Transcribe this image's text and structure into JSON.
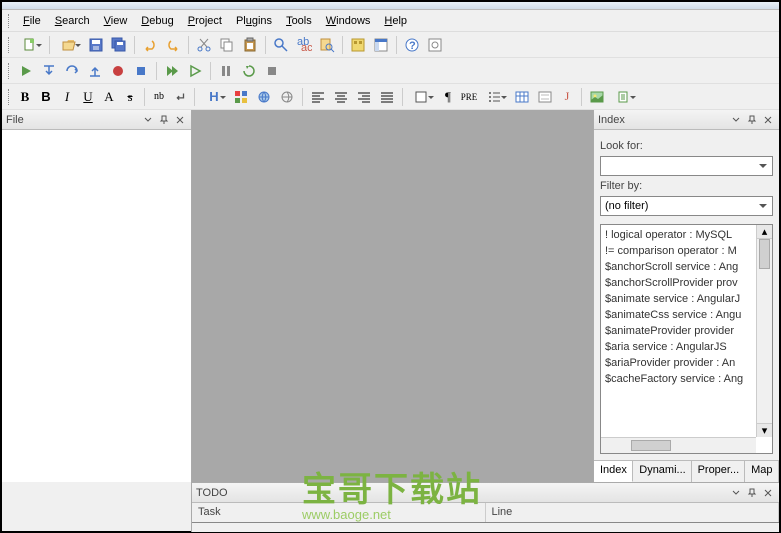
{
  "menu": {
    "file": "File",
    "search": "Search",
    "view": "View",
    "debug": "Debug",
    "project": "Project",
    "plugins": "Plugins",
    "tools": "Tools",
    "windows": "Windows",
    "help": "Help"
  },
  "panels": {
    "file_title": "File",
    "index_title": "Index",
    "todo_title": "TODO"
  },
  "index": {
    "look_for_label": "Look for:",
    "look_for_value": "",
    "filter_label": "Filter by:",
    "filter_value": "(no filter)",
    "items": [
      "! logical operator : MySQL",
      "!= comparison operator : M",
      "$anchorScroll service : Ang",
      "$anchorScrollProvider prov",
      "$animate service : AngularJ",
      "$animateCss service : Angu",
      "$animateProvider provider",
      "$aria service : AngularJS",
      "$ariaProvider provider : An",
      "$cacheFactory service : Ang"
    ],
    "tabs": [
      "Index",
      "Dynami...",
      "Proper...",
      "Map"
    ]
  },
  "todo": {
    "col_task": "Task",
    "col_line": "Line"
  },
  "watermark": {
    "big": "宝哥下载站",
    "small": "www.baoge.net"
  }
}
